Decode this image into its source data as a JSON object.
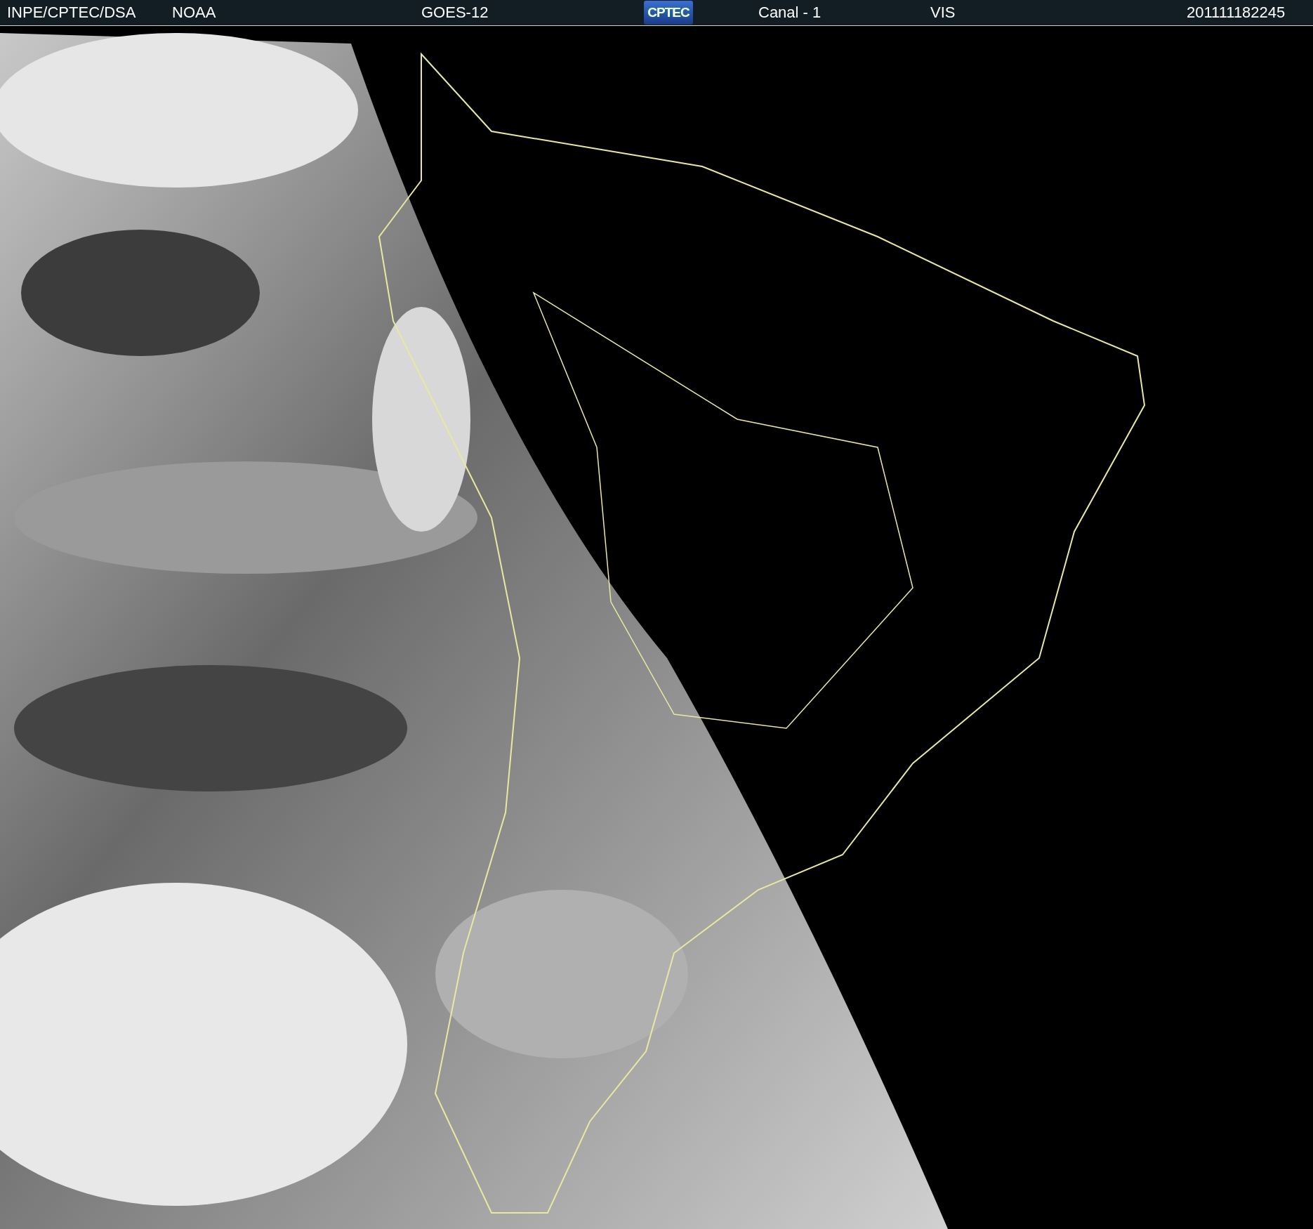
{
  "header": {
    "source": "INPE/CPTEC/DSA",
    "agency": "NOAA",
    "satellite": "GOES-12",
    "logo": "CPTEC",
    "channel": "Canal - 1",
    "band": "VIS",
    "timestamp": "201111182245"
  }
}
